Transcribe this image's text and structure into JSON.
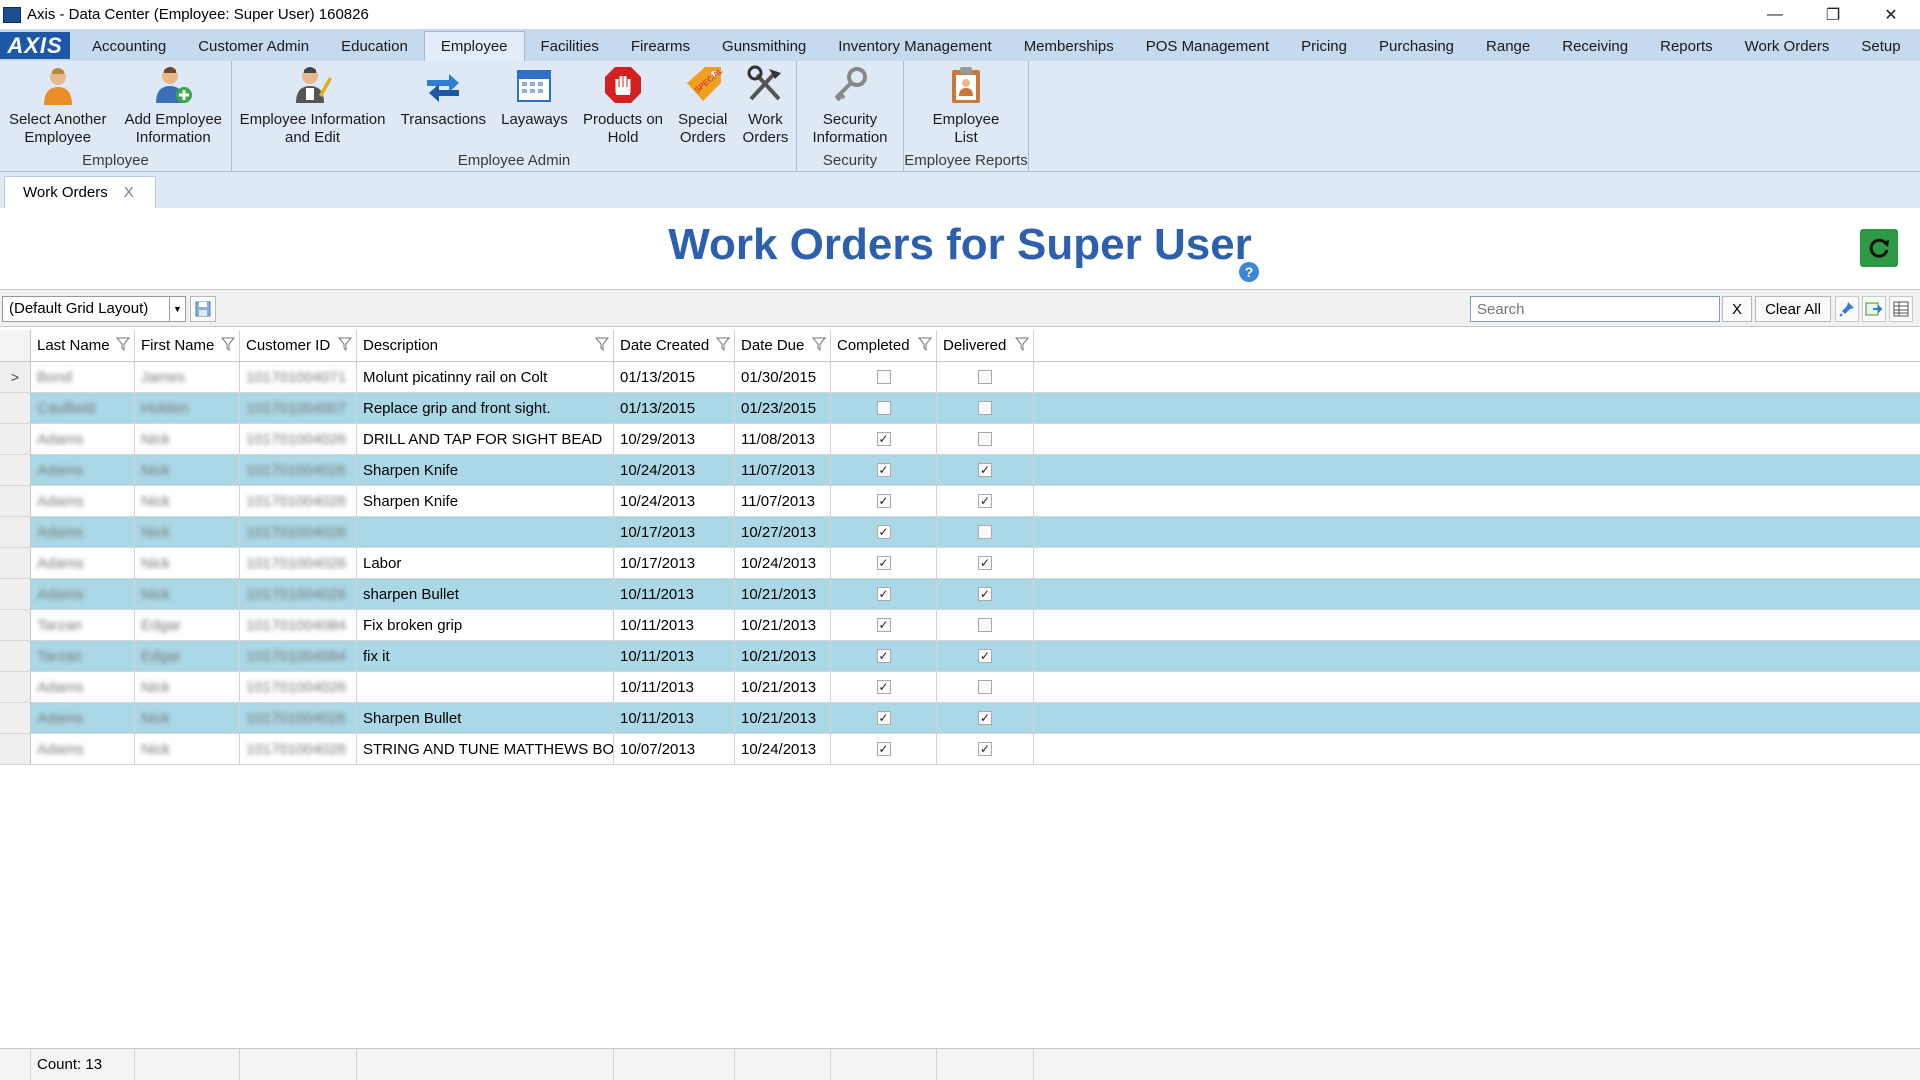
{
  "window": {
    "title": "Axis - Data Center  (Employee: Super User) 160826",
    "minimize": "—",
    "maximize": "❐",
    "close": "✕"
  },
  "logo_text": "AXIS",
  "menu": {
    "tabs": [
      "Accounting",
      "Customer Admin",
      "Education",
      "Employee",
      "Facilities",
      "Firearms",
      "Gunsmithing",
      "Inventory Management",
      "Memberships",
      "POS Management",
      "Pricing",
      "Purchasing",
      "Range",
      "Receiving",
      "Reports",
      "Work Orders",
      "Setup"
    ],
    "active": "Employee"
  },
  "ribbon": {
    "groups": [
      {
        "label": "Employee",
        "buttons": [
          {
            "label": "Select Another\nEmployee",
            "icon": "person-icon"
          },
          {
            "label": "Add Employee\nInformation",
            "icon": "add-person-icon"
          }
        ]
      },
      {
        "label": "Employee Admin",
        "buttons": [
          {
            "label": "Employee Information\nand Edit",
            "icon": "edit-person-icon"
          },
          {
            "label": "Transactions",
            "icon": "arrows-icon"
          },
          {
            "label": "Layaways",
            "icon": "calendar-icon"
          },
          {
            "label": "Products on\nHold",
            "icon": "hold-hand-icon"
          },
          {
            "label": "Special\nOrders",
            "icon": "special-tag-icon"
          },
          {
            "label": "Work\nOrders",
            "icon": "tools-icon"
          }
        ]
      },
      {
        "label": "Security",
        "buttons": [
          {
            "label": "Security\nInformation",
            "icon": "keys-icon"
          }
        ]
      },
      {
        "label": "Employee Reports",
        "buttons": [
          {
            "label": "Employee\nList",
            "icon": "clipboard-icon"
          }
        ]
      }
    ]
  },
  "doc_tab": {
    "label": "Work Orders",
    "close": "X"
  },
  "page": {
    "title": "Work Orders for Super User",
    "help": "?"
  },
  "toolbar": {
    "layout_value": "(Default Grid Layout)",
    "search_placeholder": "Search",
    "search_clear": "X",
    "clear_all": "Clear All"
  },
  "grid": {
    "columns": [
      "Last Name",
      "First Name",
      "Customer ID",
      "Description",
      "Date Created",
      "Date Due",
      "Completed",
      "Delivered"
    ],
    "current_row_marker": ">",
    "rows": [
      {
        "last": "Bond",
        "first": "James",
        "cid": "101701004071",
        "desc": "Molunt picatinny rail on Colt",
        "created": "01/13/2015",
        "due": "01/30/2015",
        "completed": false,
        "delivered": false
      },
      {
        "last": "Caulfield",
        "first": "Holden",
        "cid": "101701004007",
        "desc": "Replace grip and front sight.",
        "created": "01/13/2015",
        "due": "01/23/2015",
        "completed": false,
        "delivered": false
      },
      {
        "last": "Adams",
        "first": "Nick",
        "cid": "101701004026",
        "desc": "DRILL AND TAP FOR SIGHT BEAD",
        "created": "10/29/2013",
        "due": "11/08/2013",
        "completed": true,
        "delivered": false
      },
      {
        "last": "Adams",
        "first": "Nick",
        "cid": "101701004026",
        "desc": "Sharpen Knife",
        "created": "10/24/2013",
        "due": "11/07/2013",
        "completed": true,
        "delivered": true
      },
      {
        "last": "Adams",
        "first": "Nick",
        "cid": "101701004026",
        "desc": "Sharpen Knife",
        "created": "10/24/2013",
        "due": "11/07/2013",
        "completed": true,
        "delivered": true
      },
      {
        "last": "Adams",
        "first": "Nick",
        "cid": "101701004026",
        "desc": "",
        "created": "10/17/2013",
        "due": "10/27/2013",
        "completed": true,
        "delivered": false
      },
      {
        "last": "Adams",
        "first": "Nick",
        "cid": "101701004026",
        "desc": "Labor",
        "created": "10/17/2013",
        "due": "10/24/2013",
        "completed": true,
        "delivered": true
      },
      {
        "last": "Adams",
        "first": "Nick",
        "cid": "101701004026",
        "desc": "sharpen Bullet",
        "created": "10/11/2013",
        "due": "10/21/2013",
        "completed": true,
        "delivered": true
      },
      {
        "last": "Tarzan",
        "first": "Edgar",
        "cid": "101701004084",
        "desc": "Fix broken grip",
        "created": "10/11/2013",
        "due": "10/21/2013",
        "completed": true,
        "delivered": false
      },
      {
        "last": "Tarzan",
        "first": "Edgar",
        "cid": "101701004084",
        "desc": "fix it",
        "created": "10/11/2013",
        "due": "10/21/2013",
        "completed": true,
        "delivered": true
      },
      {
        "last": "Adams",
        "first": "Nick",
        "cid": "101701004026",
        "desc": "",
        "created": "10/11/2013",
        "due": "10/21/2013",
        "completed": true,
        "delivered": false
      },
      {
        "last": "Adams",
        "first": "Nick",
        "cid": "101701004026",
        "desc": "Sharpen Bullet",
        "created": "10/11/2013",
        "due": "10/21/2013",
        "completed": true,
        "delivered": true
      },
      {
        "last": "Adams",
        "first": "Nick",
        "cid": "101701004026",
        "desc": "STRING AND TUNE MATTHEWS BOW",
        "created": "10/07/2013",
        "due": "10/24/2013",
        "completed": true,
        "delivered": true
      }
    ]
  },
  "footer": {
    "count": "Count: 13"
  },
  "colors": {
    "title": "#2c5fae",
    "alt_row": "#abd8e6",
    "refresh": "#2c9a45"
  }
}
